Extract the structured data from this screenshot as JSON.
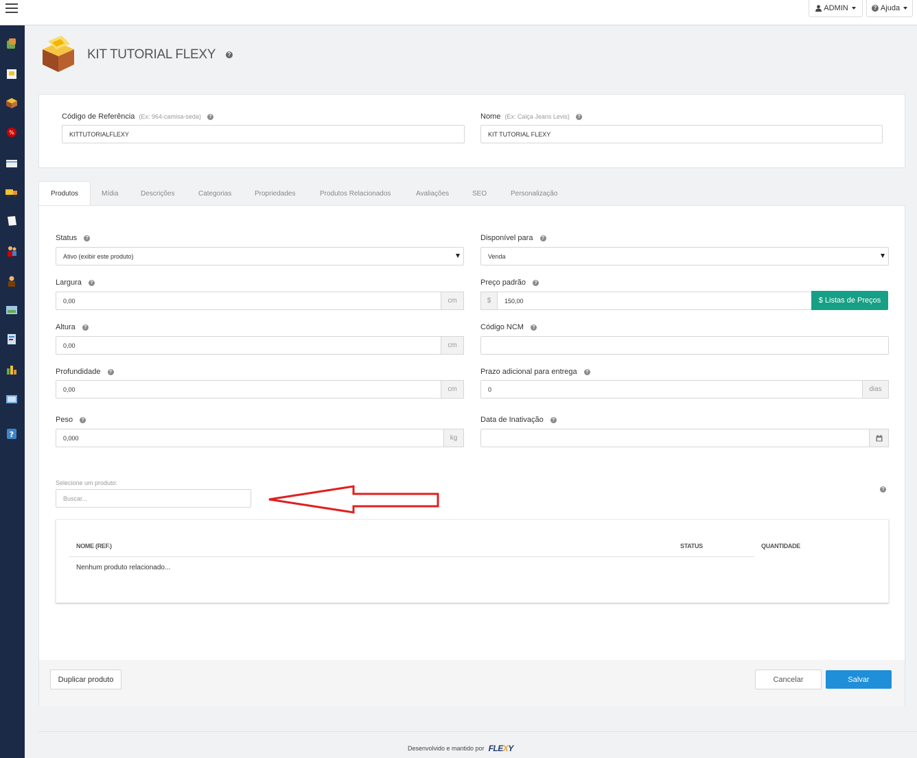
{
  "topbar": {
    "user_label": "ADMIN",
    "help_label": "Ajuda"
  },
  "header": {
    "title": "KIT TUTORIAL FLEXY"
  },
  "identity": {
    "ref_label": "Código de Referência",
    "ref_hint": "(Ex: 964-camisa-seda)",
    "ref_value": "KITTUTORIALFLEXY",
    "name_label": "Nome",
    "name_hint": "(Ex: Calça Jeans Levis)",
    "name_value": "KIT TUTORIAL FLEXY"
  },
  "tabs": [
    {
      "label": "Produtos"
    },
    {
      "label": "Mídia"
    },
    {
      "label": "Descrições"
    },
    {
      "label": "Categorias"
    },
    {
      "label": "Propriedades"
    },
    {
      "label": "Produtos Relacionados"
    },
    {
      "label": "Avaliações"
    },
    {
      "label": "SEO"
    },
    {
      "label": "Personalização"
    }
  ],
  "form": {
    "status_label": "Status",
    "status_value": "Ativo (exibir este produto)",
    "available_label": "Disponível para",
    "available_value": "Venda",
    "width_label": "Largura",
    "width_value": "0,00",
    "width_unit": "cm",
    "price_label": "Preço padrão",
    "price_prefix": "$",
    "price_value": "150,00",
    "price_lists_button": "$ Listas de Preços",
    "height_label": "Altura",
    "height_value": "0,00",
    "height_unit": "cm",
    "ncm_label": "Código NCM",
    "ncm_value": "",
    "depth_label": "Profundidade",
    "depth_value": "0,00",
    "depth_unit": "cm",
    "delivery_label": "Prazo adicional para entrega",
    "delivery_value": "0",
    "delivery_unit": "dias",
    "weight_label": "Peso",
    "weight_value": "0,000",
    "weight_unit": "kg",
    "inactivation_label": "Data de Inativação",
    "inactivation_value": ""
  },
  "product_select": {
    "label": "Selecione um produto:",
    "placeholder": "Buscar..."
  },
  "related_table": {
    "col_name": "NOME (REF.)",
    "col_status": "STATUS",
    "col_quantity": "QUANTIDADE",
    "empty_text": "Nenhum produto relacionado..."
  },
  "actions": {
    "duplicate_label": "Duplicar produto",
    "cancel_label": "Cancelar",
    "save_label": "Salvar"
  },
  "footer": {
    "text": "Desenvolvido e mantido por",
    "logo_part1": "FLE",
    "logo_part2": "X",
    "logo_part3": "Y"
  },
  "colors": {
    "sidebar": "#1b2a47",
    "accent_green": "#16a085",
    "accent_blue": "#1e8fd8",
    "arrow_red": "#e02020"
  }
}
